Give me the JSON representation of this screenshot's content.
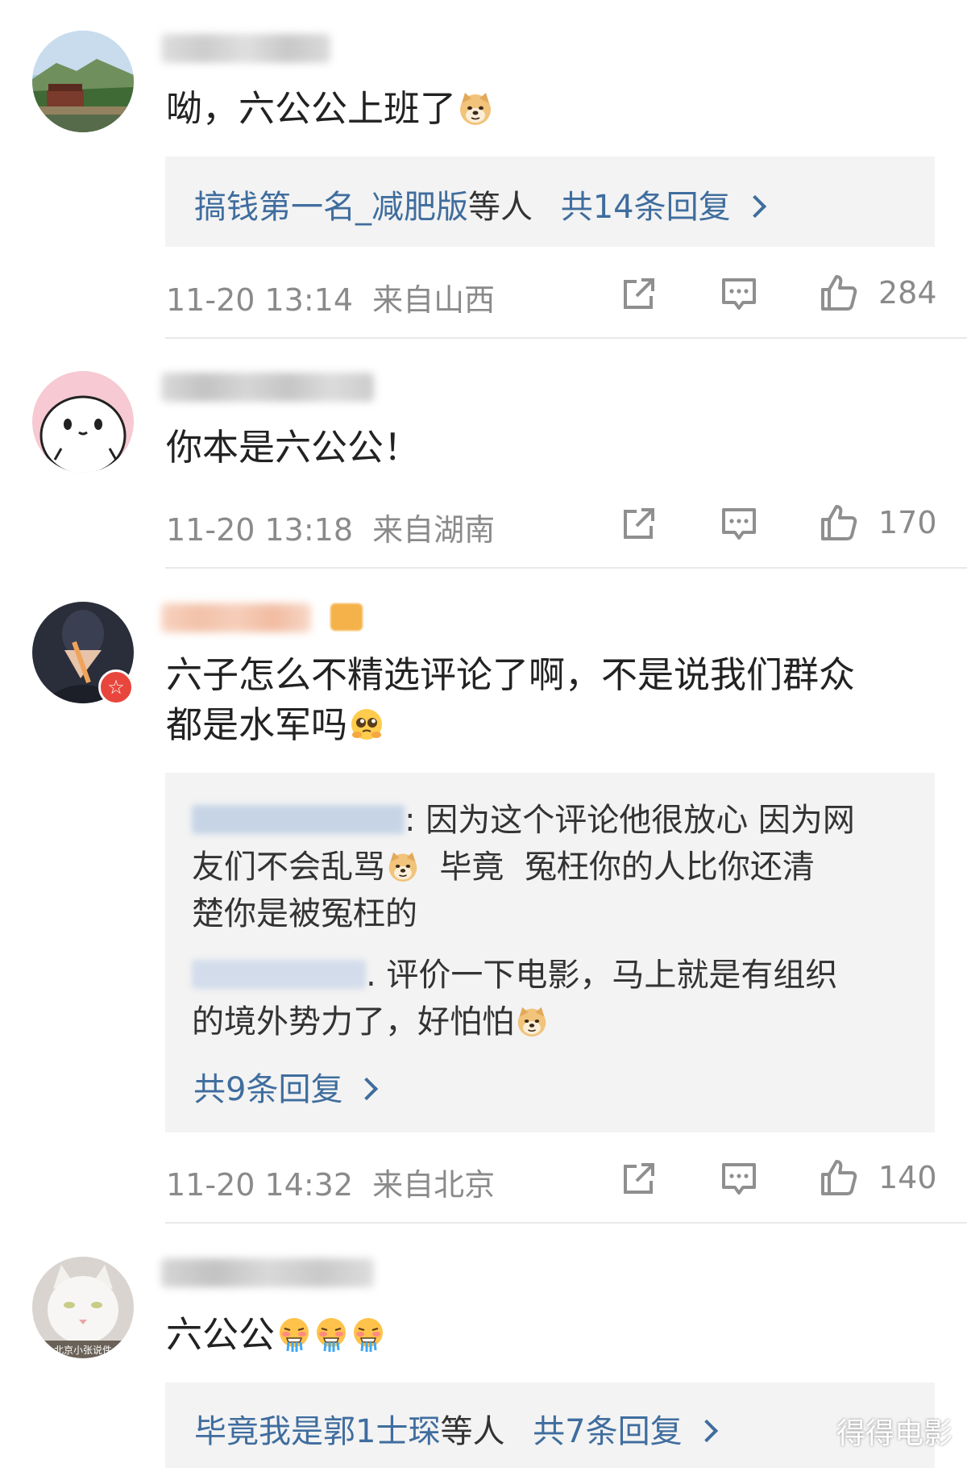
{
  "comments": [
    {
      "text": "呦，六公公上班了",
      "reply_link": {
        "users": "搞钱第一名_减肥版",
        "suffix": "等人",
        "count": "共14条回复"
      },
      "time": "11-20 13:14",
      "location": "来自山西",
      "likes": "284"
    },
    {
      "text": "你本是六公公！",
      "time": "11-20 13:18",
      "location": "来自湖南",
      "likes": "170"
    },
    {
      "text_line1": "六子怎么不精选评论了啊，不是说我们群众",
      "text_line2": "都是水军吗",
      "sub_replies": [
        {
          "line1": ": 因为这个评论他很放心 因为网",
          "line2a": "友们不会乱骂",
          "line2b": "  毕竟  冤枉你的人比你还清",
          "line3": "楚你是被冤枉的"
        },
        {
          "line1": ". 评价一下电影，马上就是有组织",
          "line2": "的境外势力了，好怕怕"
        }
      ],
      "more_replies": "共9条回复",
      "time": "11-20 14:32",
      "location": "来自北京",
      "likes": "140"
    },
    {
      "text": "六公公",
      "reply_link": {
        "users": "毕竟我是郭1士琛",
        "suffix": "等人",
        "count": "共7条回复"
      }
    }
  ],
  "avatar4_caption": "北京小张说件",
  "watermark": "得得电影",
  "icons": [
    "share-icon",
    "comment-icon",
    "like-icon",
    "doge-emoji",
    "pleading-emoji",
    "drooling-emoji",
    "chevron-right-icon",
    "vip-badge-icon"
  ],
  "colors": {
    "link": "#3f6d9e",
    "meta": "#8a8a8a",
    "reply_bg": "#f3f3f3"
  }
}
